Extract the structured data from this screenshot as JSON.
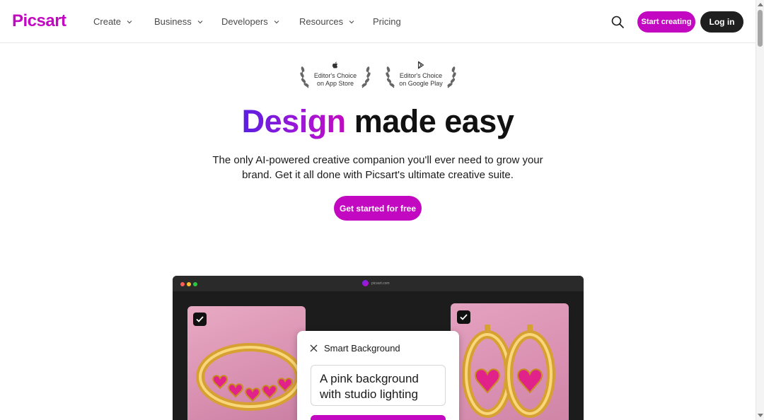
{
  "header": {
    "logo": "Picsart",
    "nav": [
      {
        "label": "Create",
        "has_dropdown": true
      },
      {
        "label": "Business",
        "has_dropdown": true
      },
      {
        "label": "Developers",
        "has_dropdown": true
      },
      {
        "label": "Resources",
        "has_dropdown": true
      },
      {
        "label": "Pricing",
        "has_dropdown": false
      }
    ],
    "start_creating": "Start creating",
    "log_in": "Log in"
  },
  "awards": [
    {
      "icon": "apple-icon",
      "title": "Editor's Choice",
      "sub": "on App Store"
    },
    {
      "icon": "google-play-icon",
      "title": "Editor's Choice",
      "sub": "on Google Play"
    }
  ],
  "hero": {
    "title_highlight": "Design",
    "title_rest": "made easy",
    "subtitle": "The only AI-powered creative companion you'll ever need to grow your brand. Get it all done with Picsart's ultimate creative suite.",
    "cta": "Get started for free"
  },
  "mockup": {
    "url": "picsart.com",
    "panel_title": "Smart Background",
    "prompt_text": "A pink background with studio lighting"
  },
  "colors": {
    "brand": "#c209c1",
    "dark_button": "#1f1f1f",
    "gradient_start": "#5a1ee0"
  }
}
